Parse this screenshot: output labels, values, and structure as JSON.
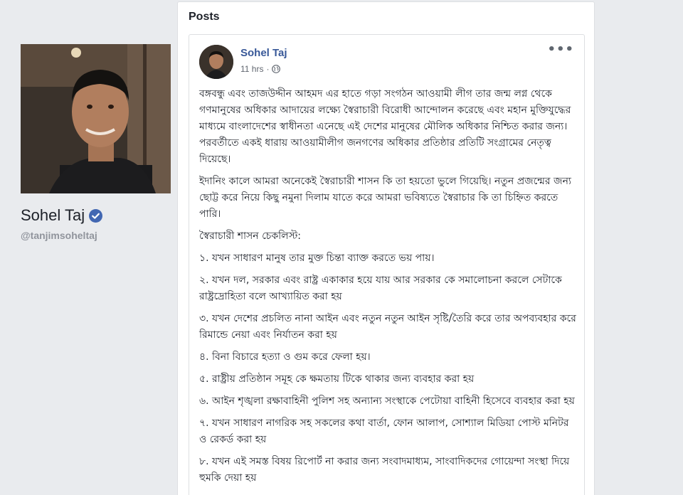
{
  "profile": {
    "name": "Sohel Taj",
    "handle": "@tanjimsoheltaj",
    "verified_color": "#4267b2"
  },
  "posts_section": {
    "title": "Posts"
  },
  "post": {
    "author": "Sohel Taj",
    "time": "11 hrs",
    "privacy_icon": "globe-icon",
    "more_icon": "more-options-icon",
    "more_label": "•••",
    "paragraphs": [
      "বঙ্গবন্ধু এবং তাজউদ্দীন আহমদ এর হাতে গড়া সংগঠন আওয়ামী লীগ তার জন্ম লগ্ন থেকে গণমানুষের অধিকার আদায়ের লক্ষ্যে স্বৈরাচারী বিরোধী আন্দোলন করেছে এবং মহান মুক্তিযুদ্ধের মাধ্যমে বাংলাদেশের স্বাধীনতা এনেছে এই দেশের মানুষের মৌলিক অধিকার নিশ্চিত করার জন্য। পরবর্তীতে একই ধারায় আওয়ামীলীগ জনগণের অধিকার প্রতিষ্ঠার প্রতিটি সংগ্রামের নেতৃত্ব দিয়েছে।",
      "ইদানিং কালে আমরা অনেকেই স্বৈরাচারী শাসন কি তা হয়তো ভুলে গিয়েছি। নতুন প্রজন্মের জন্য ছোট্ট করে নিয়ে কিছু নমুনা দিলাম যাতে করে আমরা ভবিষ্যতে স্বৈরাচার কি তা চিহ্নিত করতে পারি।",
      "স্বৈরাচারী শাসন চেকলিস্ট:",
      "১. যখন সাধারণ মানুষ তার মুক্ত চিন্তা ব্যাক্ত করতে ভয় পায়।",
      "২. যখন দল, সরকার এবং রাষ্ট্র একাকার হয়ে যায় আর সরকার কে সমালোচনা করলে সেটাকে রাষ্ট্রদ্রোহিতা বলে আখ্যায়িত করা হয়",
      "৩. যখন দেশের প্রচলিত নানা আইন এবং নতুন নতুন আইন সৃষ্টি/তৈরি করে তার অপব্যবহার করে রিমান্ডে নেয়া এবং নির্যাতন করা হয়",
      "৪. বিনা বিচারে হত্যা ও গুম করে ফেলা হয়।",
      "৫. রাষ্ট্রীয় প্রতিষ্ঠান সমূহ কে ক্ষমতায় টিকে থাকার জন্য ব্যবহার করা হয়",
      "৬. আইন শৃঙ্খলা রক্ষাবাহিনী পুলিশ সহ অন্যান্য সংস্থাকে পেটোয়া বাহিনী হিসেবে ব্যবহার করা হয়",
      "৭. যখন সাধারণ নাগরিক সহ সকলের কথা বার্তা, ফোন আলাপ, সোশ্যাল মিডিয়া পোস্ট মনিটর ও রেকর্ড করা হয়",
      "৮. যখন এই সমস্ত বিষয় রিপোর্ট না করার জন্য সংবাদমাধ্যম, সাংবাদিকদের গোয়েন্দা সংস্থা দিয়ে হুমকি দেয়া হয়"
    ]
  }
}
